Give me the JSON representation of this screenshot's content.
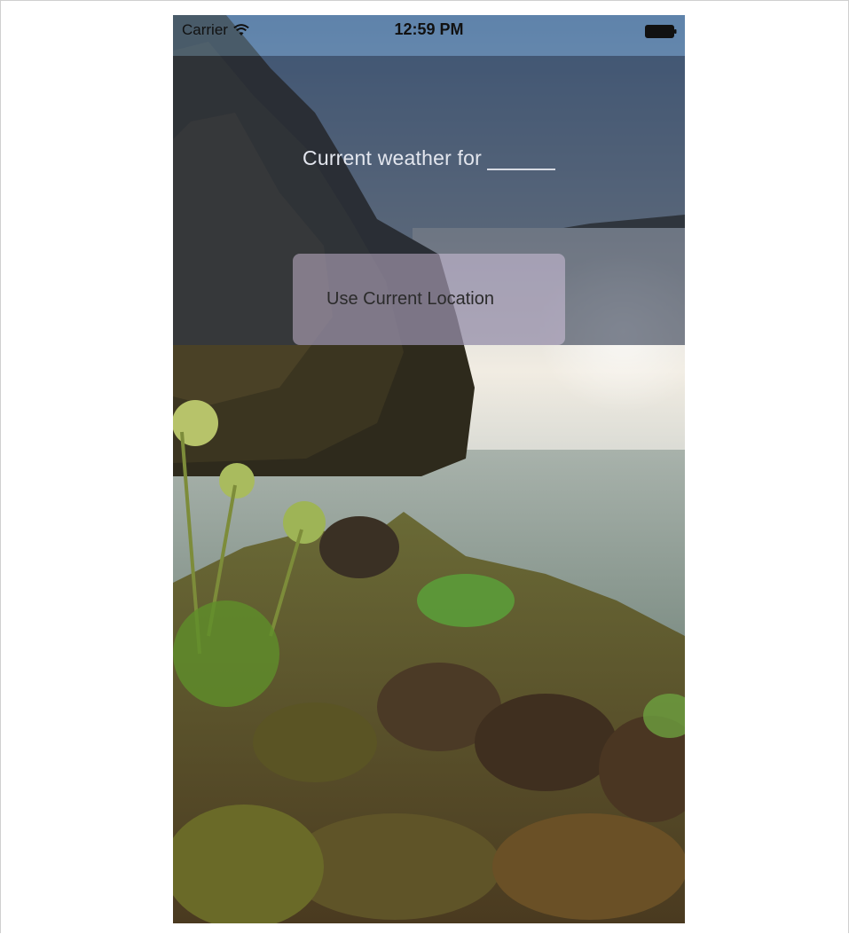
{
  "status_bar": {
    "carrier": "Carrier",
    "time": "12:59 PM",
    "wifi_icon": "wifi-icon",
    "battery_icon": "battery-icon"
  },
  "main": {
    "headline": "Current weather for",
    "location_value": "",
    "location_button_label": "Use Current Location"
  },
  "colors": {
    "status_bar_tint": "#6084aa",
    "overlay_tint": "#283248",
    "button_tint": "#eedaf8"
  }
}
